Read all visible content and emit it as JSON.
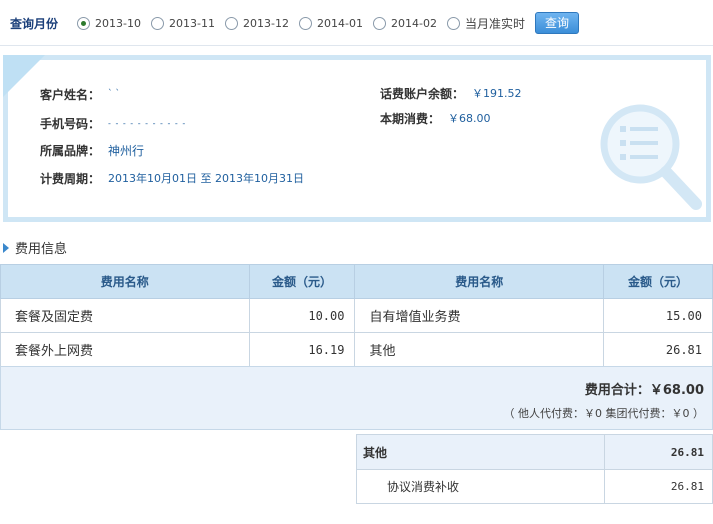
{
  "query": {
    "label": "查询月份",
    "months": [
      "2013-10",
      "2013-11",
      "2013-12",
      "2014-01",
      "2014-02",
      "当月准实时"
    ],
    "selected_index": 0,
    "button_label": "查询"
  },
  "customer": {
    "name_label": "客户姓名：",
    "name_value": "` `",
    "phone_label": "手机号码：",
    "phone_value": "- - - - - - - - - - -",
    "brand_label": "所属品牌：",
    "brand_value": "神州行",
    "period_label": "计费周期：",
    "period_value": "2013年10月01日 至 2013年10月31日",
    "balance_label": "话费账户余额：",
    "balance_value": "￥191.52",
    "current_label": "本期消费：",
    "current_value": "￥68.00"
  },
  "fees": {
    "section_title": "费用信息",
    "headers": [
      "费用名称",
      "金额（元）",
      "费用名称",
      "金额（元）"
    ],
    "rows": [
      [
        "套餐及固定费",
        "10.00",
        "自有增值业务费",
        "15.00"
      ],
      [
        "套餐外上网费",
        "16.19",
        "其他",
        "26.81"
      ]
    ],
    "total_text": "费用合计：￥68.00",
    "proxy_text": "（ 他人代付费：￥0  集团代付费：￥0 ）"
  },
  "detail": {
    "head_label": "其他",
    "head_value": "26.81",
    "items": [
      {
        "label": "协议消费补收",
        "value": "26.81"
      }
    ]
  },
  "colors": {
    "accent": "#3b8ed8",
    "header_bg": "#cbe2f3",
    "card_border": "#cfe6f5"
  }
}
